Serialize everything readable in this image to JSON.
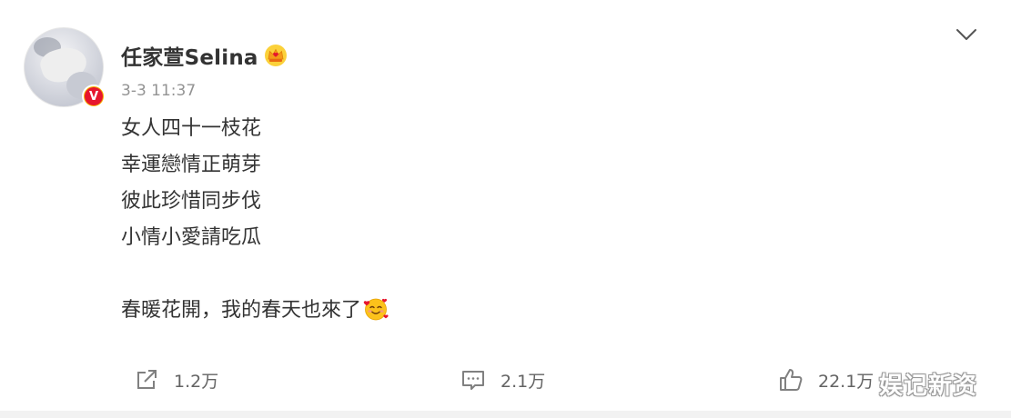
{
  "post": {
    "author": {
      "name": "任家萱Selina",
      "verified_badge_letter": "V",
      "avatar_icon": "avatar",
      "member_icon": "crown-icon"
    },
    "timestamp": "3-3 11:37",
    "lines": [
      "女人四十一枝花",
      "幸運戀情正萌芽",
      "彼此珍惜同步伐",
      "小情小愛請吃瓜"
    ],
    "closing_line": "春暖花開，我的春天也來了",
    "closing_emoji": "smiling-face-with-hearts-icon"
  },
  "actions": {
    "share": {
      "icon": "share-icon",
      "count": "1.2万"
    },
    "comment": {
      "icon": "comment-icon",
      "count": "2.1万"
    },
    "like": {
      "icon": "thumbs-up-icon",
      "count": "22.1万"
    }
  },
  "menu": {
    "icon": "chevron-down-icon"
  },
  "watermark": "娱记新资",
  "colors": {
    "text": "#333333",
    "timestamp": "#939393",
    "action_text": "#636363",
    "badge_gold": "#f7b500",
    "badge_red": "#e6162d"
  }
}
